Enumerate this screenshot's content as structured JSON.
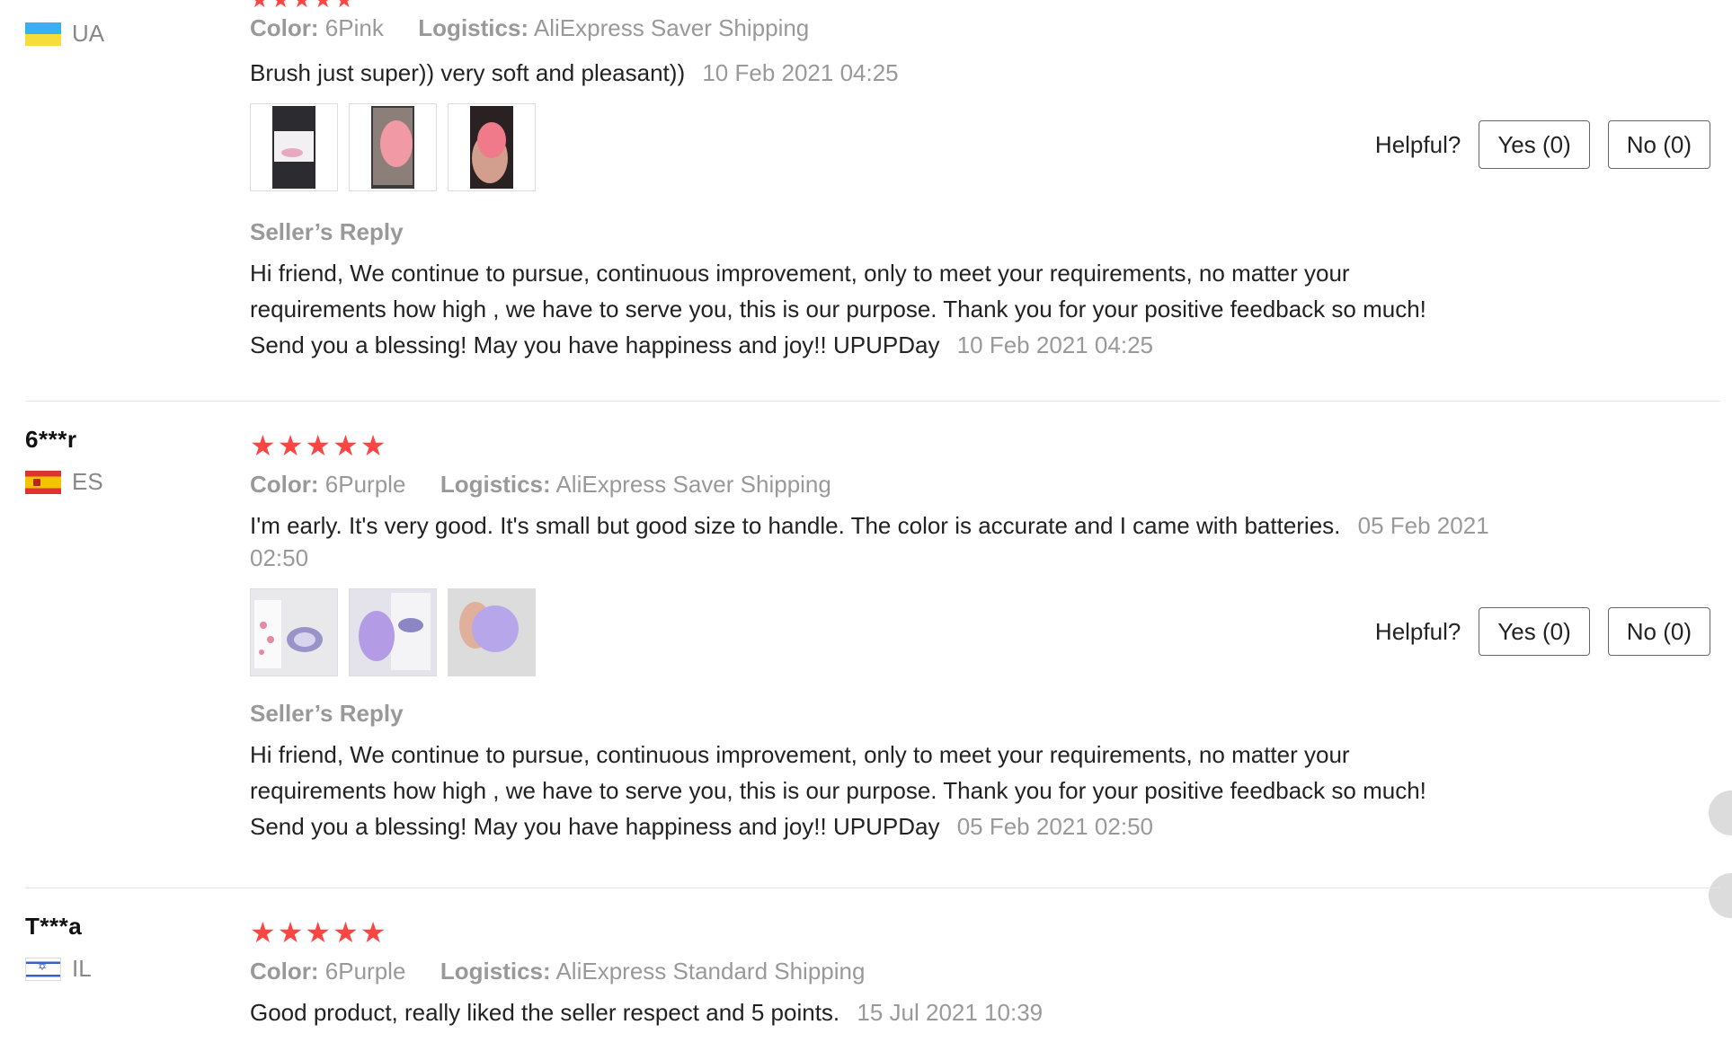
{
  "colors": {
    "star": "#ff4444",
    "meta": "#999999",
    "text": "#222222",
    "divider": "#e5e5e5"
  },
  "labels": {
    "color": "Color:",
    "logistics": "Logistics:",
    "seller_reply": "Seller’s Reply",
    "helpful": "Helpful?",
    "stars": "★★★★★"
  },
  "reviews": [
    {
      "reviewer": "",
      "country": "UA",
      "flag": "ukraine-flag",
      "rating": 5,
      "color": "6Pink",
      "logistics": "AliExpress Saver Shipping",
      "text": "Brush just super)) very soft and pleasant))",
      "date": "10 Feb 2021 04:25",
      "photos": [
        "product-photo-box",
        "product-photo-pink-brush",
        "product-photo-in-hand"
      ],
      "yes": "Yes (0)",
      "no": "No (0)",
      "reply": "Hi friend, We continue to pursue, continuous improvement, only to meet your requirements, no matter your requirements how high , we have to serve you, this is our purpose. Thank you for your positive feedback so much! Send you a blessing! May you have happiness and joy!! UPUPDay",
      "reply_date": "10 Feb 2021 04:25"
    },
    {
      "reviewer": "6***r",
      "country": "ES",
      "flag": "spain-flag",
      "rating": 5,
      "color": "6Purple",
      "logistics": "AliExpress Saver Shipping",
      "text": "I'm early. It's very good. It's small but good size to handle. The color is accurate and I came with batteries.",
      "date": "05 Feb 2021 02:50",
      "photos": [
        "product-photo-packaging",
        "product-photo-purple-brush",
        "product-photo-purple-in-hand"
      ],
      "yes": "Yes (0)",
      "no": "No (0)",
      "reply": "Hi friend, We continue to pursue, continuous improvement, only to meet your requirements, no matter your requirements how high , we have to serve you, this is our purpose. Thank you for your positive feedback so much! Send you a blessing! May you have happiness and joy!! UPUPDay",
      "reply_date": "05 Feb 2021 02:50"
    },
    {
      "reviewer": "T***a",
      "country": "IL",
      "flag": "israel-flag",
      "rating": 5,
      "color": "6Purple",
      "logistics": "AliExpress Standard Shipping",
      "text": "Good product, really liked the seller respect and 5 points.",
      "date": "15 Jul 2021 10:39"
    }
  ]
}
